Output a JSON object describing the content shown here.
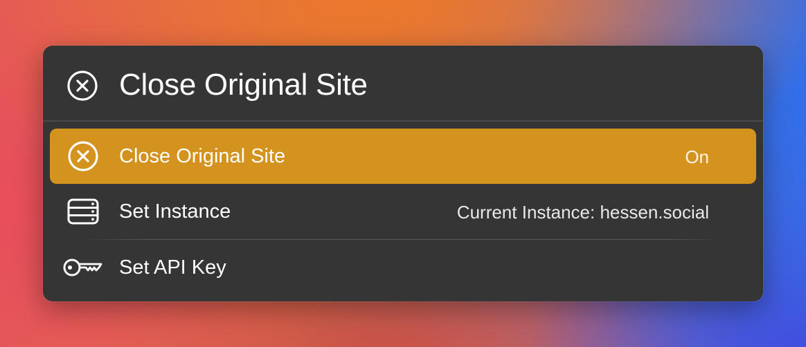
{
  "header": {
    "icon": "close-circle-icon",
    "title": "Close Original Site"
  },
  "items": [
    {
      "icon": "close-circle-icon",
      "label": "Close Original Site",
      "accessory": "On",
      "selected": true
    },
    {
      "icon": "server-icon",
      "label": "Set Instance",
      "accessory": "Current Instance: hessen.social",
      "selected": false
    },
    {
      "icon": "key-icon",
      "label": "Set API Key",
      "accessory": "",
      "selected": false
    }
  ],
  "colors": {
    "panel_background": "#353535",
    "selection_accent": "#d4931f",
    "text": "#ffffff"
  }
}
